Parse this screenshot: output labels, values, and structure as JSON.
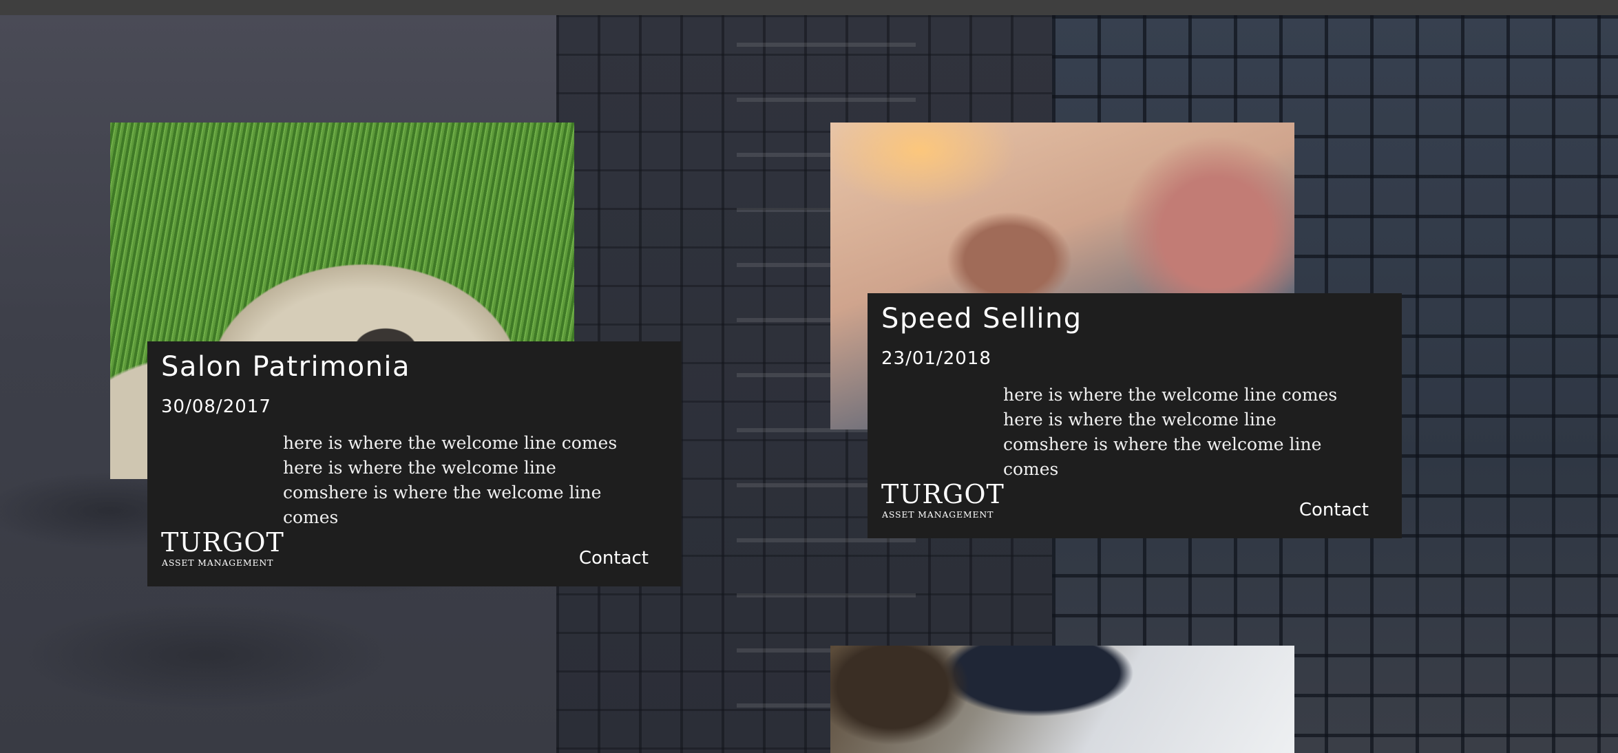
{
  "events": [
    {
      "title": "Salon Patrimonia",
      "date": "30/08/2017",
      "description": "here is where the welcome line comes here is where the welcome line comshere is where the welcome line comes",
      "logo": {
        "name": "TURGOT",
        "tagline": "ASSET MANAGEMENT"
      },
      "contact_label": "Contact"
    },
    {
      "title": "Speed Selling",
      "date": "23/01/2018",
      "description": "here is where the welcome line comes here is where the welcome line comshere is where the welcome line comes",
      "logo": {
        "name": "TURGOT",
        "tagline": "ASSET MANAGEMENT"
      },
      "contact_label": "Contact"
    }
  ],
  "colors": {
    "card_background": "#1e1e1e",
    "text": "#ffffff",
    "top_bar": "#3f3f3f"
  }
}
